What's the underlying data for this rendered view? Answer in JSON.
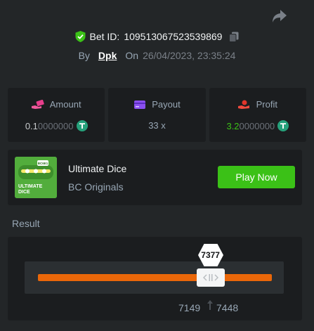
{
  "header": {
    "bet_id_label": "Bet ID:",
    "bet_id": "109513067523539869",
    "by_label": "By",
    "username": "Dpk",
    "on_label": "On",
    "date": "26/04/2023, 23:35:24"
  },
  "stats": {
    "amount": {
      "label": "Amount",
      "value_lead": "0.1",
      "value_tail": "0000000",
      "icon": "cash-hand-icon"
    },
    "payout": {
      "label": "Payout",
      "value": "33 x",
      "icon": "card-icon"
    },
    "profit": {
      "label": "Profit",
      "value_lead": "3.2",
      "value_tail": "0000000",
      "icon": "profit-hand-icon"
    }
  },
  "game": {
    "title": "Ultimate Dice",
    "provider": "BC Originals",
    "play_label": "Play Now",
    "thumb_text_1": "ULTIMATE",
    "thumb_text_2": "DICE",
    "thumb_badge": "BC6E1"
  },
  "result": {
    "label": "Result",
    "roll": "7377",
    "range_low": "7149",
    "range_high": "7448",
    "roll_value": 7377,
    "scale_max": 10000
  },
  "colors": {
    "accent_green": "#3bc117",
    "track_orange": "#ea6709",
    "background": "#232628",
    "panel": "#1b1d1f"
  }
}
